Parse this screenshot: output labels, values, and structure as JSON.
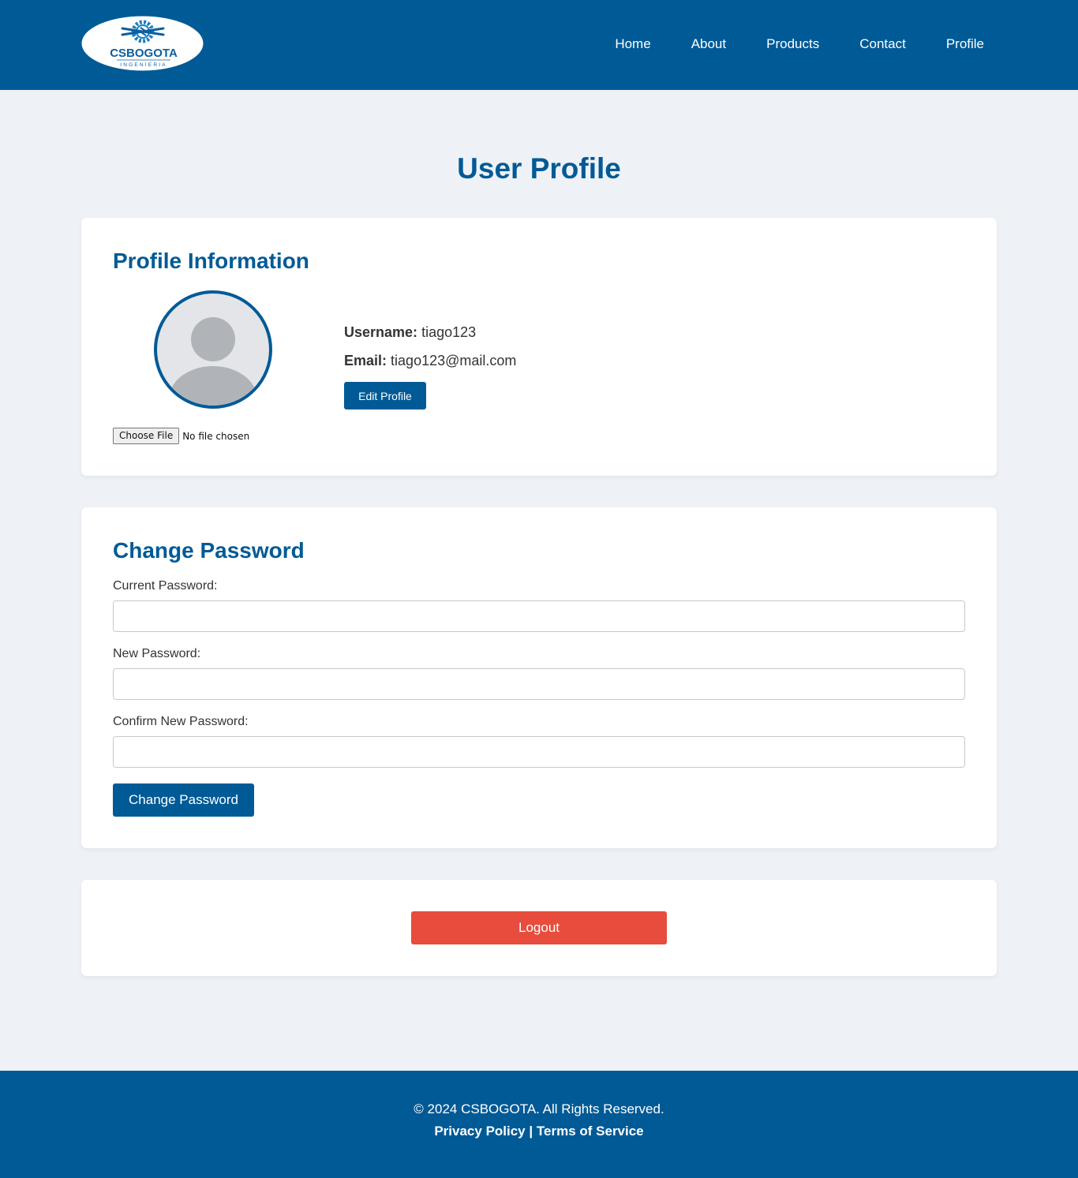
{
  "brand": {
    "logo_text": "CSBOGOTA",
    "logo_subtext": "INGENIERIA",
    "primary_color": "#005a96",
    "danger_color": "#e74c3c",
    "background_color": "#eef2f7"
  },
  "nav": {
    "items": [
      {
        "label": "Home"
      },
      {
        "label": "About"
      },
      {
        "label": "Products"
      },
      {
        "label": "Contact"
      },
      {
        "label": "Profile"
      }
    ]
  },
  "page": {
    "title": "User Profile"
  },
  "profile": {
    "section_title": "Profile Information",
    "username_label": "Username:",
    "username_value": "tiago123",
    "email_label": "Email:",
    "email_value": "tiago123@mail.com",
    "edit_button": "Edit Profile",
    "file_button": "Choose File",
    "file_status": "No file chosen",
    "avatar_icon": "user-avatar-icon"
  },
  "password": {
    "section_title": "Change Password",
    "current_label": "Current Password:",
    "new_label": "New Password:",
    "confirm_label": "Confirm New Password:",
    "submit_button": "Change Password"
  },
  "account": {
    "logout_button": "Logout"
  },
  "footer": {
    "copyright": "© 2024 CSBOGOTA. All Rights Reserved.",
    "privacy_link": "Privacy Policy",
    "separator": "|",
    "terms_link": "Terms of Service"
  }
}
